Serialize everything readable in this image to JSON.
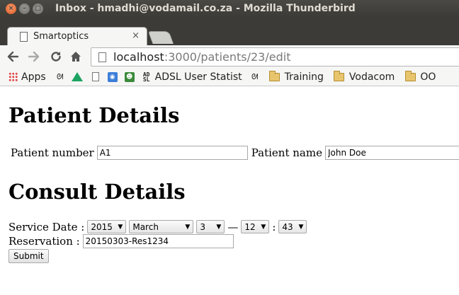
{
  "window": {
    "title": "Inbox - hmadhi@vodamail.co.za - Mozilla Thunderbird"
  },
  "browser": {
    "tab_title": "Smartoptics",
    "tab_close": "×",
    "url_host": "localhost",
    "url_path": ":3000/patients/23/edit",
    "nav": {
      "back_icon": "arrow-left-icon",
      "forward_icon": "arrow-right-icon",
      "reload_icon": "reload-icon",
      "home_icon": "home-icon"
    },
    "bookmarks": [
      {
        "label": "Apps",
        "icon": "apps-icon"
      },
      {
        "label": "",
        "icon": "robot-icon"
      },
      {
        "label": "",
        "icon": "drive-icon"
      },
      {
        "label": "",
        "icon": "page-icon"
      },
      {
        "label": "",
        "icon": "blue-square-icon"
      },
      {
        "label": "",
        "icon": "green-square-icon"
      },
      {
        "label": "ADSL User Statist",
        "icon": "adsl-icon"
      },
      {
        "label": "",
        "icon": "robot-icon"
      },
      {
        "label": "Training",
        "icon": "folder-icon"
      },
      {
        "label": "Vodacom",
        "icon": "folder-icon"
      },
      {
        "label": "OO",
        "icon": "folder-icon"
      }
    ]
  },
  "page": {
    "heading_patient": "Patient Details",
    "patient_number_label": "Patient number",
    "patient_number_value": "A1",
    "patient_name_label": "Patient name",
    "patient_name_value": "John Doe",
    "heading_consult": "Consult Details",
    "service_date_label": "Service Date :",
    "service_date": {
      "year": "2015",
      "month": "March",
      "day": "3",
      "separator": "—",
      "hour": "12",
      "time_separator": ":",
      "minute": "43"
    },
    "reservation_label": "Reservation :",
    "reservation_value": "20150303-Res1234",
    "submit_label": "Submit"
  }
}
